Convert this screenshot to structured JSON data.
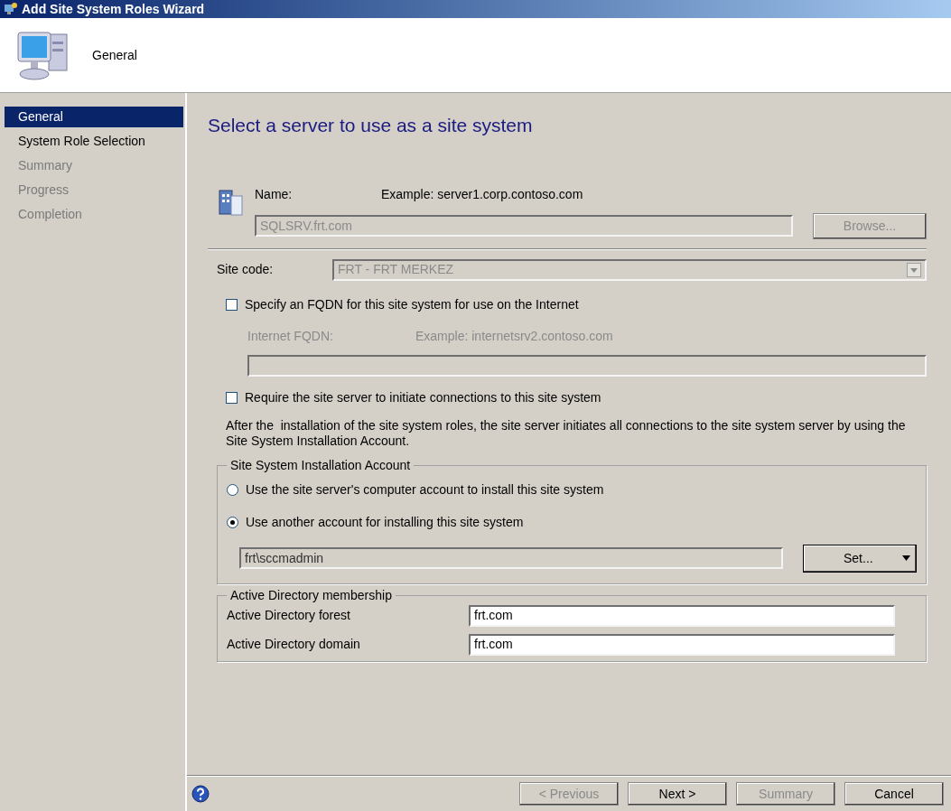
{
  "window": {
    "title": "Add Site System Roles Wizard"
  },
  "header": {
    "title": "General"
  },
  "steps": [
    {
      "label": "General",
      "selected": true,
      "disabled": false
    },
    {
      "label": "System Role Selection",
      "selected": false,
      "disabled": false
    },
    {
      "label": "Summary",
      "selected": false,
      "disabled": true
    },
    {
      "label": "Progress",
      "selected": false,
      "disabled": true
    },
    {
      "label": "Completion",
      "selected": false,
      "disabled": true
    }
  ],
  "page_title": "Select a server to use as a site system",
  "name": {
    "label": "Name:",
    "example": "Example: server1.corp.contoso.com",
    "value": "SQLSRV.frt.com",
    "disabled": true,
    "browse": {
      "label": "Browse...",
      "disabled": true
    }
  },
  "site_code": {
    "label": "Site code:",
    "value": "FRT - FRT MERKEZ",
    "disabled": true
  },
  "fqdn": {
    "checkbox": {
      "label": "Specify an FQDN for this site system for use on the Internet",
      "checked": false
    },
    "label": "Internet FQDN:",
    "example": "Example: internetsrv2.contoso.com",
    "disabled": true
  },
  "require": {
    "label": "Require the site server to initiate connections to this site system",
    "checked": false
  },
  "note": "After the  installation of the site system roles, the site server initiates all connections to the site system server by using the Site System Installation Account.",
  "account": {
    "title": "Site System Installation Account",
    "options": [
      {
        "label": "Use the site server's computer account to install this site system",
        "selected": false
      },
      {
        "label": "Use another account for installing this site system",
        "selected": true
      }
    ],
    "value": "frt\\sccmadmin",
    "set_button": "Set..."
  },
  "ad": {
    "title": "Active Directory membership",
    "fields": [
      {
        "label": "Active Directory forest",
        "value": "frt.com"
      },
      {
        "label": "Active Directory domain",
        "value": "frt.com"
      }
    ]
  },
  "buttons": [
    {
      "label": "< Previous",
      "disabled": true
    },
    {
      "label": "Next >",
      "disabled": false
    },
    {
      "label": "Summary",
      "disabled": true
    },
    {
      "label": "Cancel",
      "disabled": false
    }
  ]
}
